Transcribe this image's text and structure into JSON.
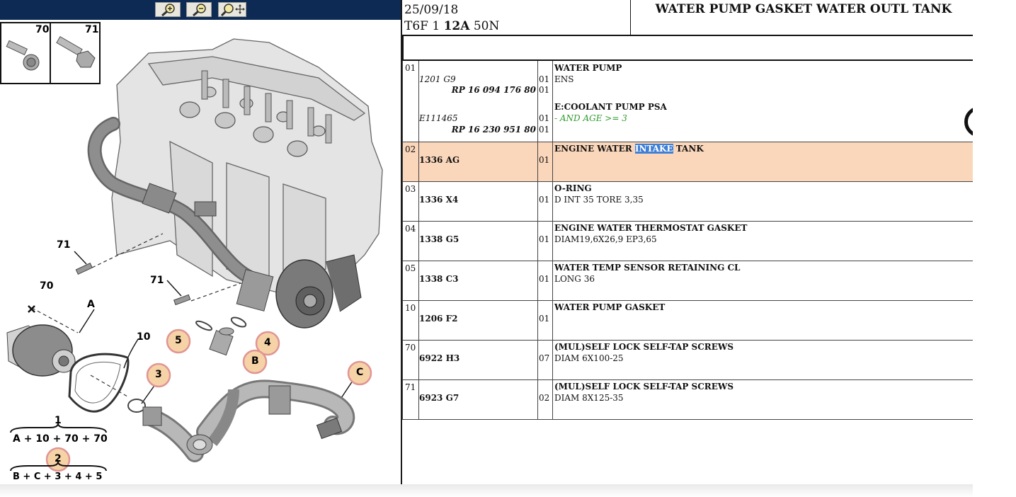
{
  "toolbar": {
    "zoom_in_icon": "zoom-in-icon",
    "zoom_out_icon": "zoom-out-icon",
    "pan_icon": "zoom-move-icon"
  },
  "diagram": {
    "thumb1_label": "70",
    "thumb2_label": "71",
    "callouts": {
      "l71a": "71",
      "l70": "70",
      "l71b": "71",
      "lA": "A",
      "l10": "10",
      "l5": "5",
      "l4": "4",
      "lB": "B",
      "l3": "3",
      "lC": "C",
      "l1": "1",
      "l2": "2"
    },
    "formula1": "A + 10 + 70 + 70",
    "formula2": "B + C + 3 + 4 + 5"
  },
  "header": {
    "date": "25/09/18",
    "code_prefix": "T6F 1 ",
    "code_bold": "12A",
    "code_suffix": " 50N",
    "title": "WATER PUMP GASKET WATER OUTL TANK"
  },
  "rows": [
    {
      "num": "01",
      "ref1": "1201 G9",
      "rp1": "RP 16 094 176 80",
      "qty1a": "01",
      "qty1b": "01",
      "desc1": "WATER PUMP",
      "sub1": "ENS",
      "ref2": "E111465",
      "rp2": "RP 16 230 951 80",
      "qty2a": "01",
      "qty2b": "01",
      "desc2": "E:COOLANT PUMP PSA",
      "sub2": "- AND AGE >= 3"
    },
    {
      "num": "02",
      "ref": "1336 AG",
      "qty": "01",
      "desc_a": "ENGINE WATER ",
      "desc_sel": "INTAKE",
      "desc_b": " TANK"
    },
    {
      "num": "03",
      "ref": "1336 X4",
      "qty": "01",
      "desc": "O-RING",
      "sub": "D INT 35 TORE 3,35"
    },
    {
      "num": "04",
      "ref": "1338 G5",
      "qty": "01",
      "desc": "ENGINE WATER THERMOSTAT GASKET",
      "sub": "DIAM19,6X26,9 EP3,65"
    },
    {
      "num": "05",
      "ref": "1338 C3",
      "qty": "01",
      "desc": "WATER TEMP SENSOR RETAINING CL",
      "sub": "LONG 36"
    },
    {
      "num": "10",
      "ref": "1206 F2",
      "qty": "01",
      "desc": "WATER PUMP GASKET"
    },
    {
      "num": "70",
      "ref": "6922 H3",
      "qty": "07",
      "desc": "(MUL)SELF LOCK SELF-TAP SCREWS",
      "sub": "DIAM 6X100-25"
    },
    {
      "num": "71",
      "ref": "6923 G7",
      "qty": "02",
      "desc": "(MUL)SELF LOCK SELF-TAP SCREWS",
      "sub": "DIAM 8X125-35"
    }
  ],
  "colors": {
    "toolbar_bg": "#0d2a54",
    "highlight_row": "#fad7bb",
    "selection": "#3f7fd6",
    "green_note": "#2e9a2e",
    "callout_circle": "#f6d3a6"
  }
}
